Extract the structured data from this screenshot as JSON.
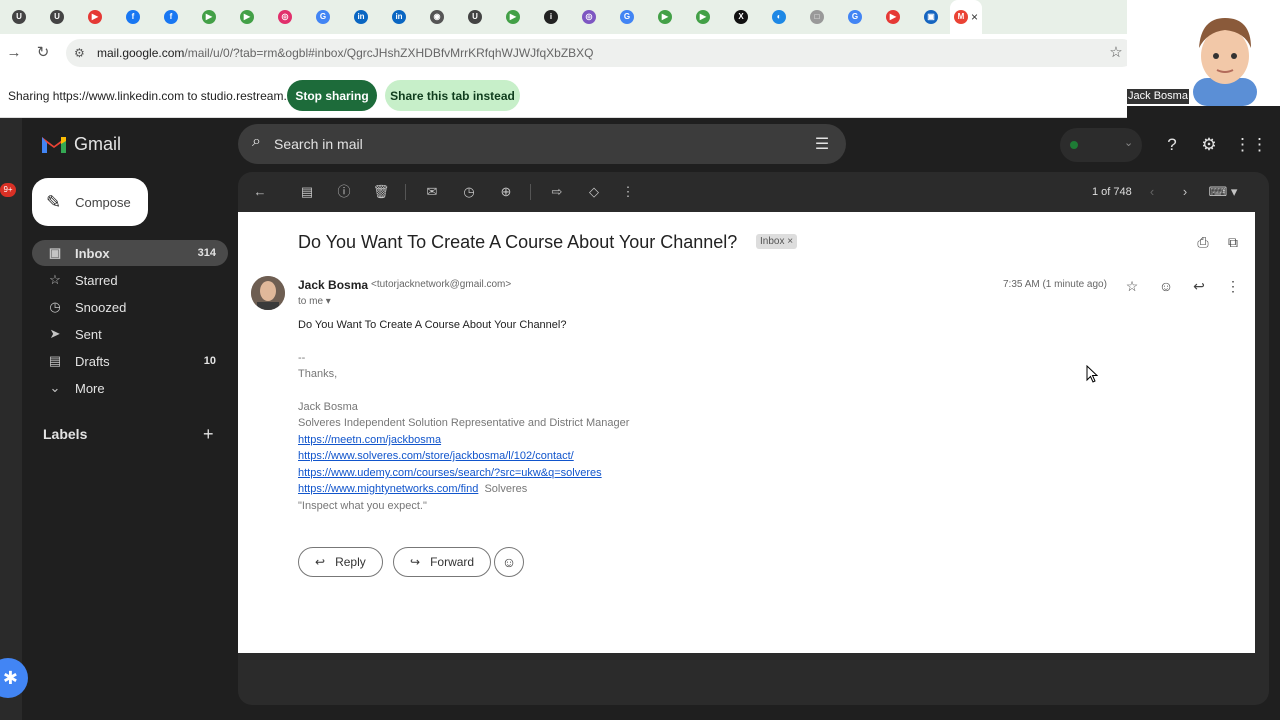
{
  "browser": {
    "tabs": [
      {
        "letter": "U",
        "color": "#444"
      },
      {
        "letter": "U",
        "color": "#444"
      },
      {
        "letter": "▶",
        "color": "#e53935"
      },
      {
        "letter": "f",
        "color": "#1877f2"
      },
      {
        "letter": "f",
        "color": "#1877f2"
      },
      {
        "letter": "▶",
        "color": "#43a047"
      },
      {
        "letter": "▶",
        "color": "#43a047"
      },
      {
        "letter": "◎",
        "color": "#e1306c"
      },
      {
        "letter": "G",
        "color": "#4285f4"
      },
      {
        "letter": "in",
        "color": "#0a66c2"
      },
      {
        "letter": "in",
        "color": "#0a66c2"
      },
      {
        "letter": "◉",
        "color": "#555"
      },
      {
        "letter": "U",
        "color": "#444"
      },
      {
        "letter": "▶",
        "color": "#43a047"
      },
      {
        "letter": "i",
        "color": "#222"
      },
      {
        "letter": "◎",
        "color": "#7e57c2"
      },
      {
        "letter": "G",
        "color": "#4285f4"
      },
      {
        "letter": "▶",
        "color": "#43a047"
      },
      {
        "letter": "▶",
        "color": "#43a047"
      },
      {
        "letter": "X",
        "color": "#111"
      },
      {
        "letter": "◐",
        "color": "#1e88e5"
      },
      {
        "letter": "□",
        "color": "#999"
      },
      {
        "letter": "G",
        "color": "#4285f4"
      },
      {
        "letter": "▶",
        "color": "#e53935"
      },
      {
        "letter": "▣",
        "color": "#1565c0"
      }
    ],
    "url_host": "mail.google.com",
    "url_path": "/mail/u/0/?tab=rm&ogbl#inbox/QgrcJHshZXHDBfvMrrKRfqhWJWJfqXbZBXQ"
  },
  "sharing": {
    "text": "Sharing https://www.linkedin.com to studio.restream.io",
    "stop_label": "Stop sharing",
    "share_tab_label": "Share this tab instead"
  },
  "webcam": {
    "name": "Jack Bosma"
  },
  "gmail": {
    "logo_text": "Gmail",
    "search_placeholder": "Search in mail",
    "compose_label": "Compose",
    "nav": [
      {
        "key": "inbox",
        "label": "Inbox",
        "icon": "inbox-icon",
        "glyph": "▣",
        "count": "314",
        "active": true
      },
      {
        "key": "starred",
        "label": "Starred",
        "icon": "star-icon",
        "glyph": "☆",
        "count": "",
        "active": false
      },
      {
        "key": "snoozed",
        "label": "Snoozed",
        "icon": "clock-icon",
        "glyph": "◷",
        "count": "",
        "active": false
      },
      {
        "key": "sent",
        "label": "Sent",
        "icon": "send-icon",
        "glyph": "➤",
        "count": "",
        "active": false
      },
      {
        "key": "drafts",
        "label": "Drafts",
        "icon": "draft-icon",
        "glyph": "▤",
        "count": "10",
        "active": false
      },
      {
        "key": "more",
        "label": "More",
        "icon": "chevron-down-icon",
        "glyph": "⌄",
        "count": "",
        "active": false
      }
    ],
    "labels_heading": "Labels",
    "left_badge": "9+",
    "pager": "1 of 748"
  },
  "email": {
    "subject": "Do You Want To Create A Course About Your Channel?",
    "chip": "Inbox",
    "sender_name": "Jack Bosma",
    "sender_email": "<tutorjacknetwork@gmail.com>",
    "to": "to me",
    "time": "7:35 AM (1 minute ago)",
    "body_first": "Do You Want To Create A Course About Your Channel?",
    "sig_dash": "--",
    "thanks": "Thanks,",
    "sig_name": "Jack Bosma",
    "sig_title": "Solveres Independent Solution Representative and District Manager",
    "links": [
      "https://meetn.com/jackbosma",
      "https://www.solveres.com/store/jackbosma/l/102/contact/",
      "https://www.udemy.com/courses/search/?src=ukw&q=solveres",
      "https://www.mightynetworks.com/find"
    ],
    "link4_suffix": "Solveres",
    "quote": "\"Inspect what you expect.\"",
    "reply_label": "Reply",
    "forward_label": "Forward"
  }
}
